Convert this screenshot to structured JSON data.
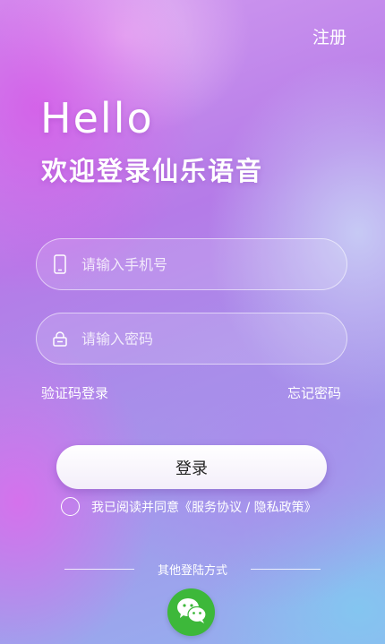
{
  "header": {
    "register_label": "注册"
  },
  "greeting": {
    "hello": "Hello",
    "welcome": "欢迎登录仙乐语音"
  },
  "form": {
    "phone_placeholder": "请输入手机号",
    "password_placeholder": "请输入密码",
    "sms_login_label": "验证码登录",
    "forgot_password_label": "忘记密码",
    "login_button_label": "登录"
  },
  "agreement": {
    "prefix": "我已阅读并同意",
    "link": "《服务协议 / 隐私政策》",
    "checked": false
  },
  "other_login": {
    "label": "其他登陆方式",
    "methods": [
      {
        "icon": "wechat-icon",
        "color": "#3db83a"
      }
    ]
  },
  "theme": {
    "accent": "#b57be8",
    "button_bg": "#ffffff",
    "wechat_green": "#3db83a"
  }
}
